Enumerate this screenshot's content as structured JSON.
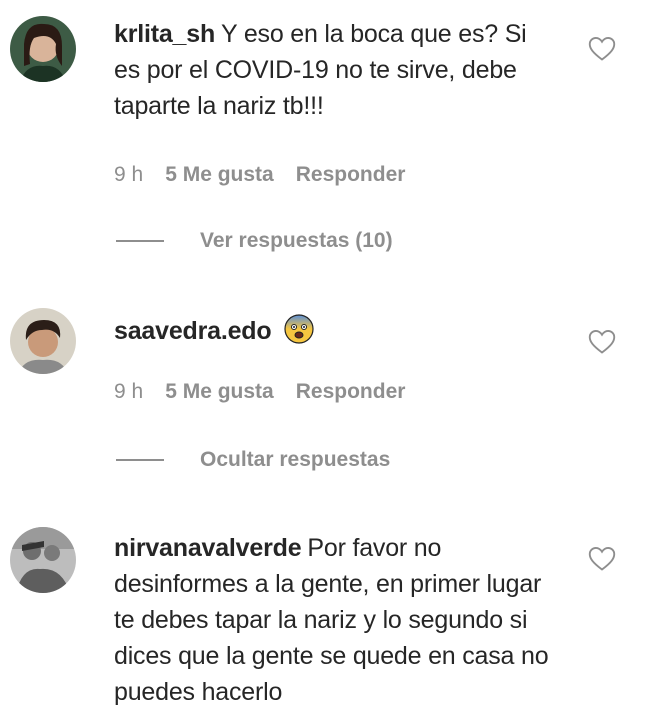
{
  "comments": [
    {
      "username": "krlita_sh",
      "text": "Y eso en la boca que es? Si es por el COVID-19 no te sirve, debe taparte la nariz tb!!!",
      "time": "9 h",
      "likes": "5 Me gusta",
      "reply": "Responder",
      "replies_toggle": "Ver respuestas (10)"
    },
    {
      "username": "saavedra.edo",
      "text": "",
      "emoji": "fearful-face-emoji",
      "time": "9 h",
      "likes": "5 Me gusta",
      "reply": "Responder",
      "replies_toggle": "Ocultar respuestas"
    },
    {
      "username": "nirvanavalverde",
      "text": "Por favor no desinformes a la gente, en primer lugar te debes tapar la nariz y lo segundo si dices que la gente se quede en casa no puedes hacerlo"
    }
  ],
  "icons": {
    "like": "heart-outline-icon"
  },
  "colors": {
    "text": "#262626",
    "meta": "#8e8e8e"
  }
}
